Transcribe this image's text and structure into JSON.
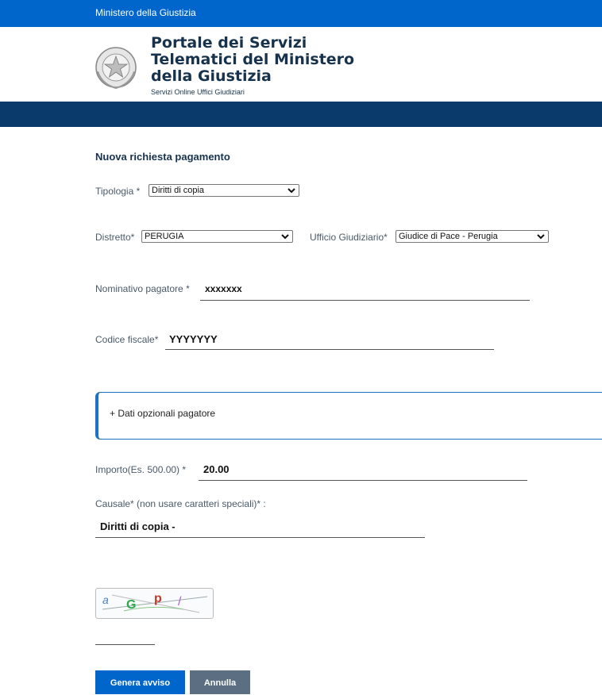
{
  "header": {
    "ministry_label": "Ministero della Giustizia",
    "portal_title_line1": "Portale dei Servizi",
    "portal_title_line2": "Telematici del Ministero",
    "portal_title_line3": "della Giustizia",
    "subtitle": "Servizi Online Uffici Giudiziari",
    "emblem_icon": "emblem-icon"
  },
  "form": {
    "title": "Nuova richiesta pagamento",
    "tipologia": {
      "label": "Tipologia *",
      "value": "Diritti di copia"
    },
    "distretto": {
      "label": "Distretto*",
      "value": "PERUGIA"
    },
    "ufficio": {
      "label": "Ufficio Giudiziario*",
      "value": "Giudice di Pace - Perugia"
    },
    "nominativo": {
      "label": "Nominativo pagatore *",
      "value": "xxxxxxx"
    },
    "codice_fiscale": {
      "label": "Codice fiscale*",
      "value": "YYYYYYY"
    },
    "optional": {
      "label": "+ Dati opzionali pagatore"
    },
    "importo": {
      "label": "Importo(Es. 500.00) *",
      "value": "20.00"
    },
    "causale": {
      "label": "Causale* (non usare caratteri speciali)* :",
      "value": "Diritti di copia -"
    },
    "captcha": {
      "chars": [
        "a",
        "G",
        "p",
        "/"
      ]
    }
  },
  "buttons": {
    "genera": "Genera avviso",
    "annulla": "Annulla"
  },
  "colors": {
    "primary": "#0066cc",
    "navbar": "#0a3a6b",
    "secondary_button": "#5c6f82"
  }
}
